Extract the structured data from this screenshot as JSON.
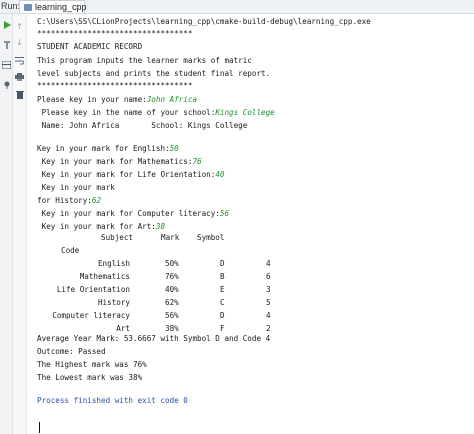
{
  "run_bar": {
    "label": "Run:",
    "tab_label": "learning_cpp",
    "close_glyph": "×"
  },
  "icons": {
    "toolbar": [
      "play-icon",
      "up-arrow-icon",
      "down-arrow-icon",
      "wrench-icon",
      "soft-wrap-icon",
      "layout-icon",
      "print-icon",
      "pin-icon",
      "trash-icon"
    ],
    "accent_play": "#3c9f3c",
    "input_color": "#1f8f2f",
    "process_color": "#2652a8"
  },
  "console": {
    "exe_path": "C:\\Users\\SS\\CLionProjects\\learning_cpp\\cmake-build-debug\\learning_cpp.exe",
    "stars1": "**********************************",
    "title": "STUDENT ACADEMIC RECORD",
    "desc1": "This program inputs the learner marks of matric",
    "desc2": "level subjects and prints the student final report.",
    "stars2": "**********************************",
    "name_prompt": "Please key in your name:",
    "name_input": "John Africa",
    "school_prompt": " Please key in the name of your school:",
    "school_input": "Kings College",
    "name_school_line": " Name: John Africa       School: Kings College",
    "english_prompt": "Key in your mark for English:",
    "english_input": "50",
    "math_prompt": " Key in your mark for Mathematics:",
    "math_input": "76",
    "lo_prompt": " Key in your mark for Life Orientation:",
    "lo_input": "40",
    "history_prompt1": " Key in your mark",
    "history_prompt2": "for History:",
    "history_input": "62",
    "cl_prompt": " Key in your mark for Computer literacy:",
    "cl_input": "56",
    "art_prompt": " Key in your mark for Art:",
    "art_input": "38",
    "table_header": {
      "subject": "Subject",
      "mark": "Mark",
      "symbol": "Symbol",
      "code": "Code"
    },
    "rows": [
      {
        "subject": "English",
        "mark": "50%",
        "symbol": "D",
        "code": "4"
      },
      {
        "subject": "Mathematics",
        "mark": "76%",
        "symbol": "B",
        "code": "6"
      },
      {
        "subject": "Life Orientation",
        "mark": "40%",
        "symbol": "E",
        "code": "3"
      },
      {
        "subject": "History",
        "mark": "62%",
        "symbol": "C",
        "code": "5"
      },
      {
        "subject": "Computer literacy",
        "mark": "56%",
        "symbol": "D",
        "code": "4"
      },
      {
        "subject": "Art",
        "mark": "38%",
        "symbol": "F",
        "code": "2"
      }
    ],
    "average_line": "Average Year Mark: 53.6667 with Symbol D and Code 4",
    "outcome_line": "Outcome: Passed",
    "highest_line": "The Highest mark was 76%",
    "lowest_line": "The Lowest mark was 38%",
    "process_line": "Process finished with exit code 0"
  }
}
